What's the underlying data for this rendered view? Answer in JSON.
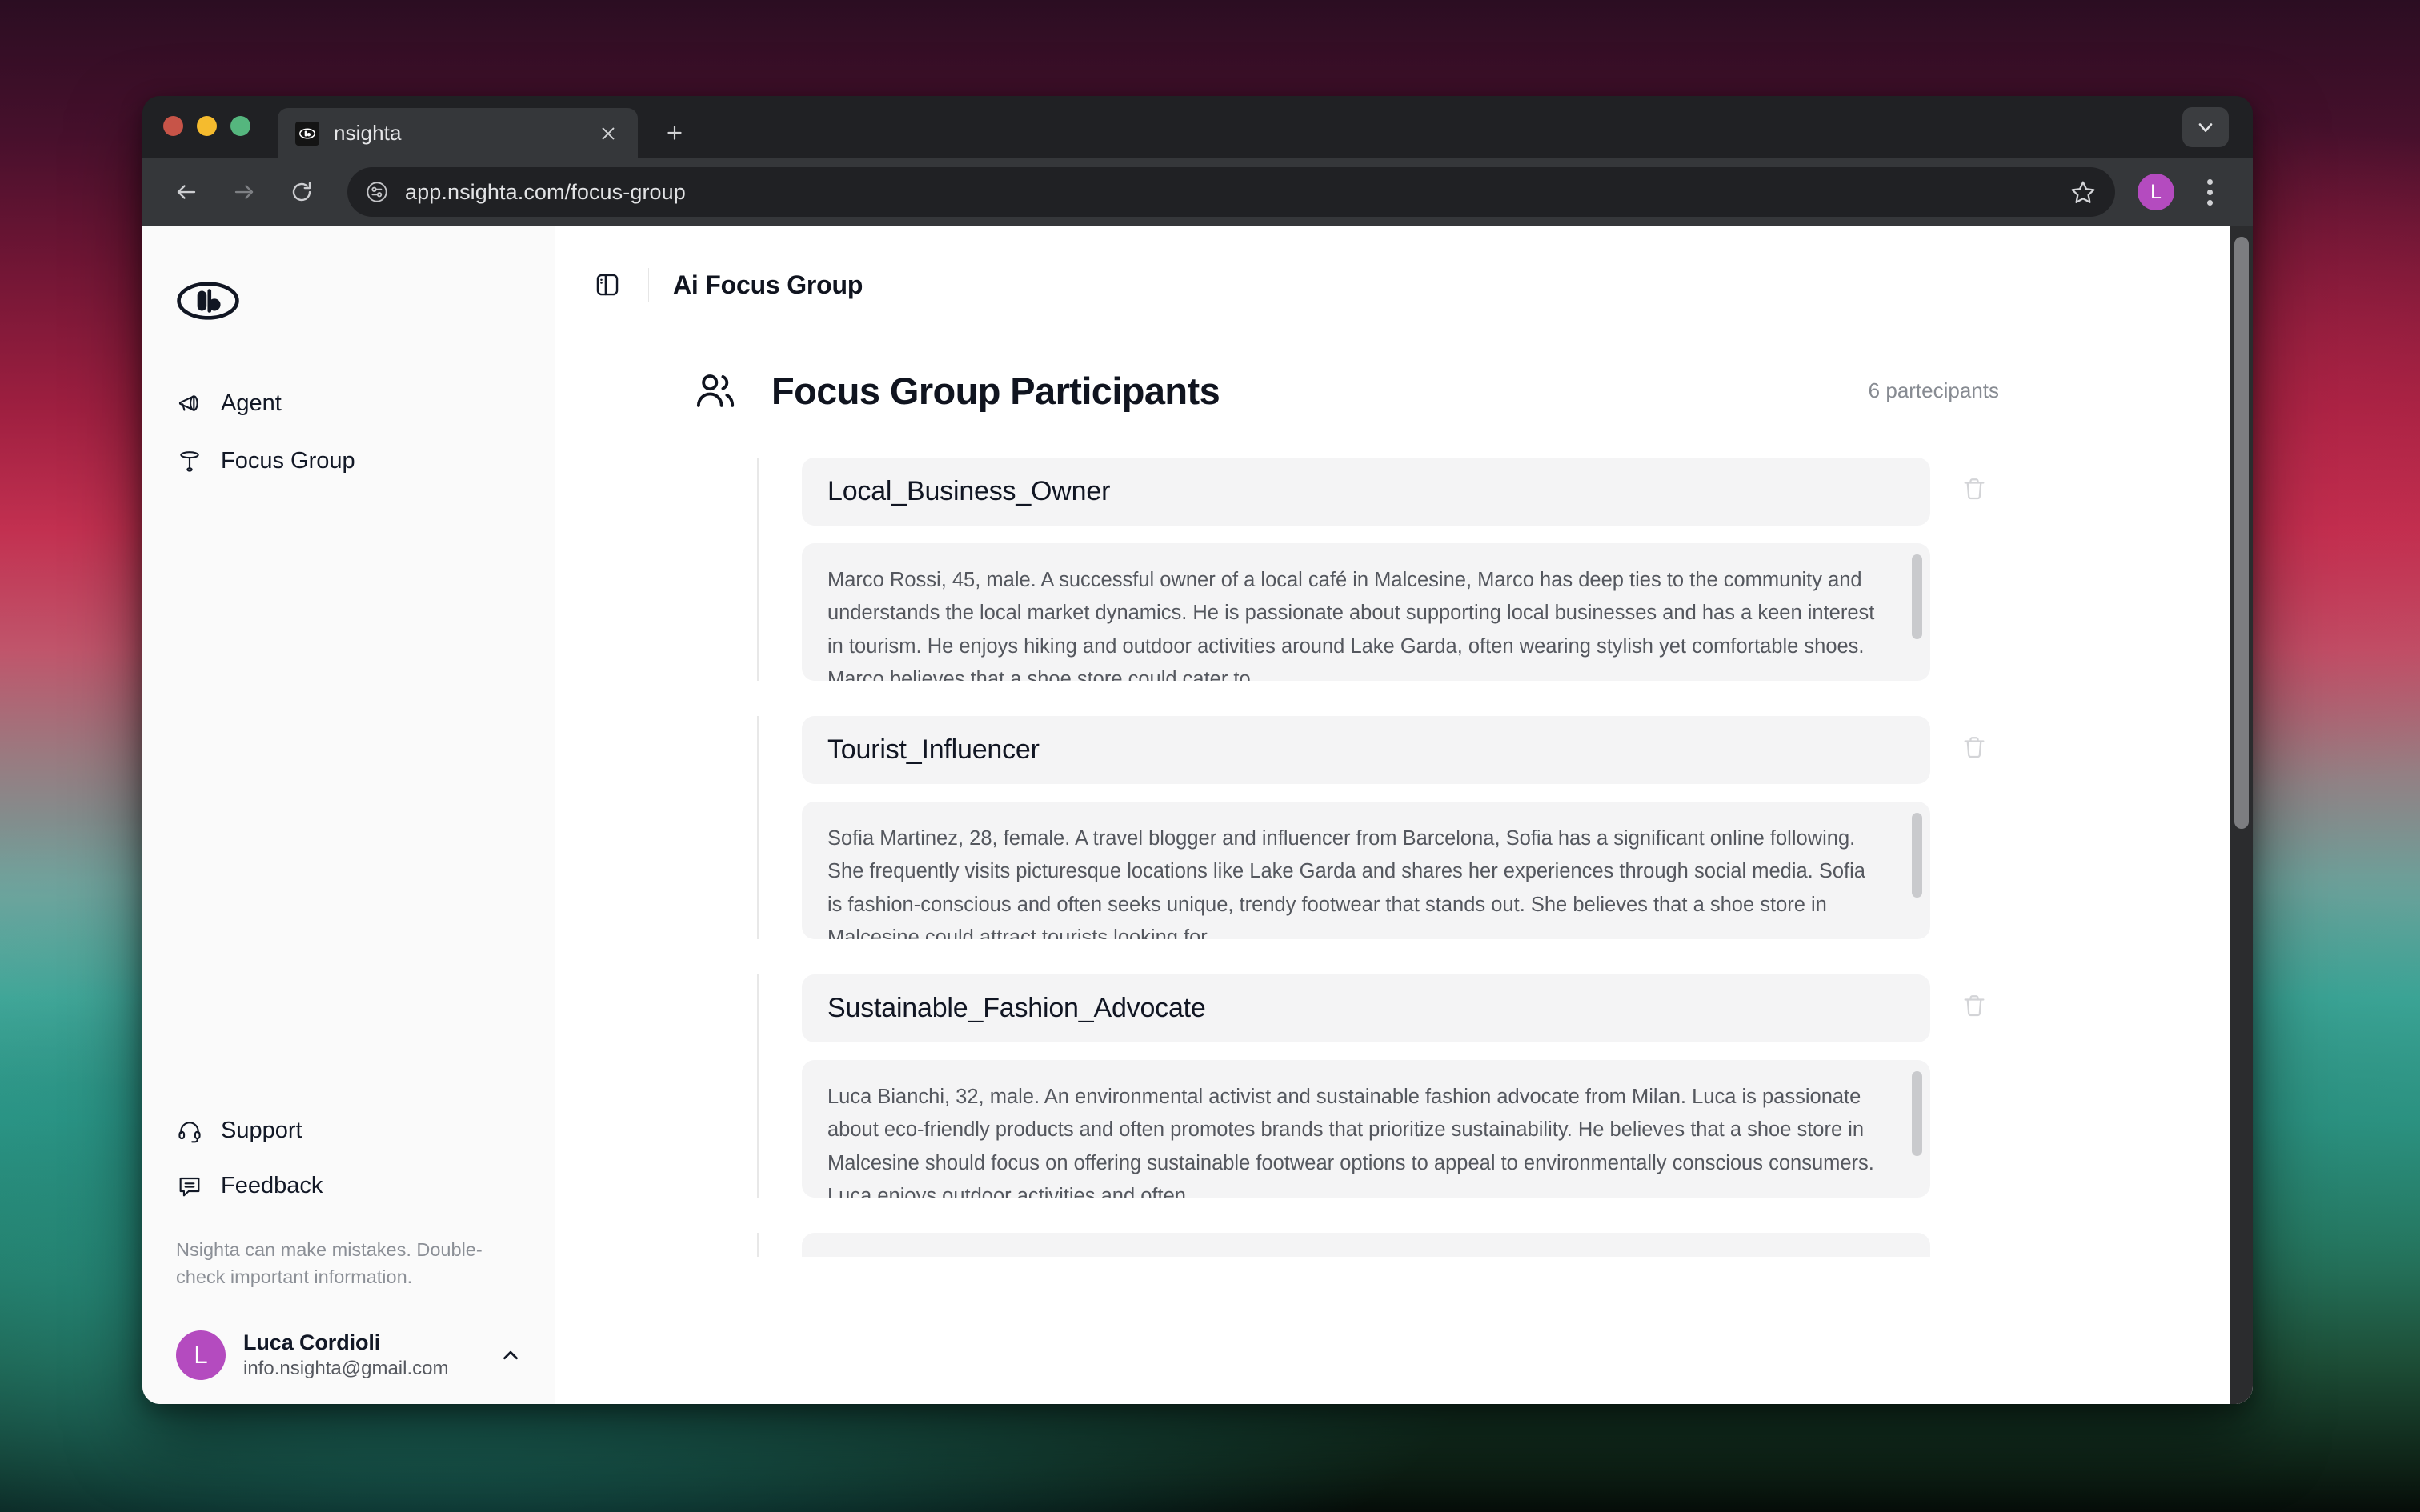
{
  "browser": {
    "traffic_lights": [
      "close",
      "minimize",
      "maximize"
    ],
    "tab": {
      "title": "nsighta",
      "favicon": "nsighta-eye-icon",
      "close_icon": "close-icon"
    },
    "new_tab_label": "+",
    "tab_list_chevron": "chevron-down-icon",
    "back_icon": "arrow-left-icon",
    "forward_icon": "arrow-right-icon",
    "reload_icon": "reload-icon",
    "site_info_icon": "site-settings-icon",
    "url": "app.nsighta.com/focus-group",
    "bookmark_icon": "star-icon",
    "profile_initial": "L",
    "menu_icon": "kebab-menu-icon"
  },
  "sidebar": {
    "logo_name": "nsighta-eye-logo",
    "items": [
      {
        "label": "Agent",
        "icon": "megaphone-icon"
      },
      {
        "label": "Focus Group",
        "icon": "funnel-icon"
      }
    ],
    "bottom_items": [
      {
        "label": "Support",
        "icon": "headset-icon"
      },
      {
        "label": "Feedback",
        "icon": "message-square-icon"
      }
    ],
    "disclaimer": "Nsighta can make mistakes. Double-check important information.",
    "user": {
      "initial": "L",
      "name": "Luca Cordioli",
      "email": "info.nsighta@gmail.com",
      "chevron": "chevron-up-icon",
      "avatar_color": "#b44bbf"
    }
  },
  "main": {
    "panel_toggle_icon": "panel-left-icon",
    "title": "Ai Focus Group",
    "section": {
      "icon": "users-icon",
      "title": "Focus Group Participants",
      "count_label": "6 partecipants"
    },
    "participants": [
      {
        "name": "Local_Business_Owner",
        "description": "Marco Rossi, 45, male. A successful owner of a local café in Malcesine, Marco has deep ties to the community and understands the local market dynamics. He is passionate about supporting local businesses and has a keen interest in tourism. He enjoys hiking and outdoor activities around Lake Garda, often wearing stylish yet comfortable shoes. Marco believes that a shoe store could cater to",
        "delete_icon": "trash-icon"
      },
      {
        "name": "Tourist_Influencer",
        "description": "Sofia Martinez, 28, female. A travel blogger and influencer from Barcelona, Sofia has a significant online following. She frequently visits picturesque locations like Lake Garda and shares her experiences through social media. Sofia is fashion-conscious and often seeks unique, trendy footwear that stands out. She believes that a shoe store in Malcesine could attract tourists looking for",
        "delete_icon": "trash-icon"
      },
      {
        "name": "Sustainable_Fashion_Advocate",
        "description": "Luca Bianchi, 32, male. An environmental activist and sustainable fashion advocate from Milan. Luca is passionate about eco-friendly products and often promotes brands that prioritize sustainability. He believes that a shoe store in Malcesine should focus on offering sustainable footwear options to appeal to environmentally conscious consumers. Luca enjoys outdoor activities and often",
        "delete_icon": "trash-icon"
      }
    ]
  }
}
